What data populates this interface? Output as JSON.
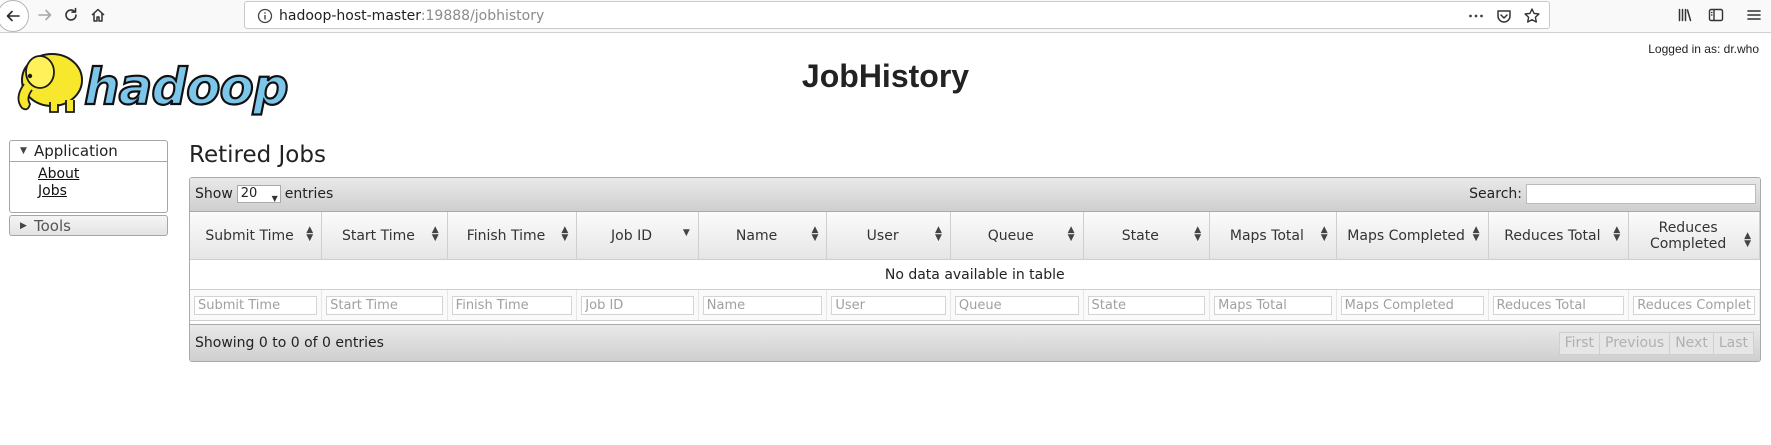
{
  "browser": {
    "url_host": "hadoop-host-master",
    "url_rest": ":19888/jobhistory",
    "icons": [
      "back-icon",
      "forward-icon",
      "reload-icon",
      "home-icon",
      "info-icon",
      "more-icon",
      "pocket-icon",
      "bookmark-star-icon",
      "library-icon",
      "sidebar-icon",
      "menu-icon"
    ]
  },
  "header": {
    "logo_text": "hadoop",
    "title": "JobHistory",
    "logged_in": "Logged in as: dr.who"
  },
  "nav": {
    "application_label": "Application",
    "links": [
      "About",
      "Jobs"
    ],
    "tools_label": "Tools"
  },
  "main": {
    "section_title": "Retired Jobs",
    "show_label": "Show",
    "entries_label": "entries",
    "page_length": "20",
    "search_label": "Search:",
    "columns": [
      "Submit Time",
      "Start Time",
      "Finish Time",
      "Job ID",
      "Name",
      "User",
      "Queue",
      "State",
      "Maps Total",
      "Maps Completed",
      "Reduces Total",
      "Reduces Completed"
    ],
    "filters": [
      "Submit Time",
      "Start Time",
      "Finish Time",
      "Job ID",
      "Name",
      "User",
      "Queue",
      "State",
      "Maps Total",
      "Maps Completed",
      "Reduces Total",
      "Reduces Completed"
    ],
    "empty_message": "No data available in table",
    "info": "Showing 0 to 0 of 0 entries",
    "pager": [
      "First",
      "Previous",
      "Next",
      "Last"
    ]
  }
}
